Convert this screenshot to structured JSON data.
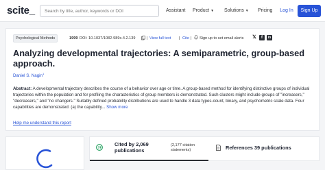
{
  "navbar": {
    "logo": "scite_",
    "search_placeholder": "Search by title, author, keywords or DOI",
    "links": {
      "assistant": "Assistant",
      "product": "Product",
      "solutions": "Solutions",
      "pricing": "Pricing"
    },
    "login": "Log In",
    "signup": "Sign Up"
  },
  "paper": {
    "journal": "Psychological Methods",
    "year": "1999",
    "doi": "DOI: 10.1037/1082-989x.4.2.139",
    "view_full_text": "View full text",
    "cite": "Cite",
    "alerts": "Sign up to set email alerts",
    "title": "Analyzing developmental trajectories: A semiparametric, group-based approach.",
    "author": "Daniel S. Nagin",
    "author_sup": "1",
    "abstract_label": "Abstract:",
    "abstract": "A developmental trajectory describes the course of a behavior over age or time. A group-based method for identifying distinctive groups of individual trajectories within the population and for profiling the characteristics of group members is demonstrated. Such clusters might include groups of \"increasers,\" \"decreasers,\" and \"no changers.\" Suitably defined probability distributions are used to handle 3 data types-count, binary, and psychometric scale data. Four capabilities are demonstrated: (a) the capability...",
    "show_more": "Show more",
    "help_link": "Help me understand this report"
  },
  "tabs": {
    "cited_by": "Cited by 2,069 publications",
    "statements": "(2,177 citation statements)",
    "references": "References 39 publications"
  },
  "colors": {
    "accent": "#2853d7",
    "cite_icon": "#1e9e5a"
  }
}
